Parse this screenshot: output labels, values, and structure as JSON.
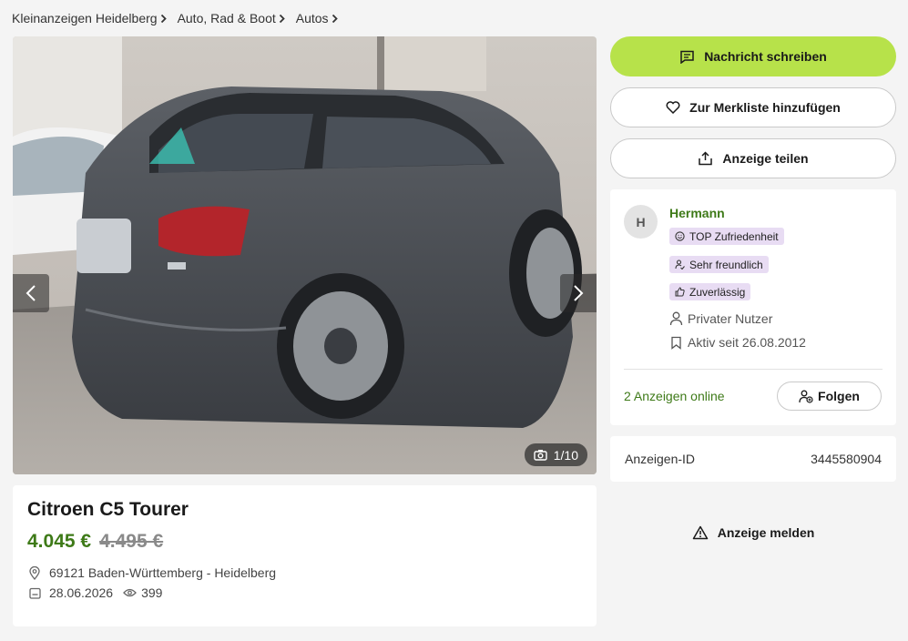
{
  "breadcrumb": [
    {
      "label": "Kleinanzeigen Heidelberg"
    },
    {
      "label": "Auto, Rad & Boot"
    },
    {
      "label": "Autos"
    }
  ],
  "gallery": {
    "counter": "1/10",
    "icons": {
      "prev": "chevron-left-icon",
      "next": "chevron-right-icon",
      "counter": "camera-icon"
    },
    "image_alt": "Citroen C5 Tourer"
  },
  "ad": {
    "title": "Citroen C5 Tourer",
    "price": "4.045 €",
    "old_price": "4.495 €",
    "location": "69121 Baden-Württemberg - Heidelberg",
    "date": "28.06.2026",
    "views": "399"
  },
  "actions": {
    "message": "Nachricht schreiben",
    "watchlist": "Zur Merkliste hinzufügen",
    "share": "Anzeige teilen",
    "report": "Anzeige melden"
  },
  "seller": {
    "initial": "H",
    "name": "Hermann",
    "badges": [
      "TOP Zufriedenheit",
      "Sehr freundlich",
      "Zuverlässig"
    ],
    "type": "Privater Nutzer",
    "active_since": "Aktiv seit 26.08.2012",
    "online_ads": "2 Anzeigen online",
    "follow": "Folgen"
  },
  "ad_id": {
    "label": "Anzeigen-ID",
    "value": "3445580904"
  },
  "colors": {
    "accent_green": "#b7e24a",
    "text_green": "#3e7a18",
    "badge_bg": "#e8dcf3",
    "page_bg": "#f4f4f4"
  }
}
